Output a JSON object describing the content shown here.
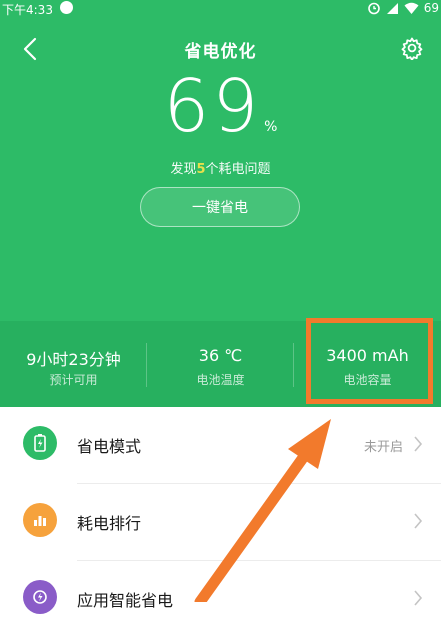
{
  "status_bar": {
    "time": "下午4:33",
    "icons": [
      "app-icon",
      "alarm-icon",
      "signal-icon",
      "wifi-icon"
    ],
    "battery": "69"
  },
  "header": {
    "title": "省电优化",
    "back_icon": "back-arrow-icon",
    "settings_icon": "gear-icon"
  },
  "score": {
    "value": "69",
    "unit": "%"
  },
  "issues": {
    "prefix": "发现",
    "count": "5",
    "suffix": "个耗电问题"
  },
  "one_key_button": {
    "label": "一键省电"
  },
  "stats": [
    {
      "value": "9小时23分钟",
      "label": "预计可用"
    },
    {
      "value": "36 ℃",
      "label": "电池温度"
    },
    {
      "value": "3400 mAh",
      "label": "电池容量"
    }
  ],
  "rows": [
    {
      "label": "省电模式",
      "value": "未开启",
      "icon": "battery-mode-icon",
      "color": "#2dbb67"
    },
    {
      "label": "耗电排行",
      "value": "",
      "icon": "bar-chart-icon",
      "color": "#f6a23c"
    },
    {
      "label": "应用智能省电",
      "value": "",
      "icon": "smart-save-icon",
      "color": "#8a5cc8"
    }
  ],
  "colors": {
    "primary_green": "#2dbb67",
    "highlight_orange": "#f27a2c",
    "issue_count_yellow": "#f2e24a"
  }
}
